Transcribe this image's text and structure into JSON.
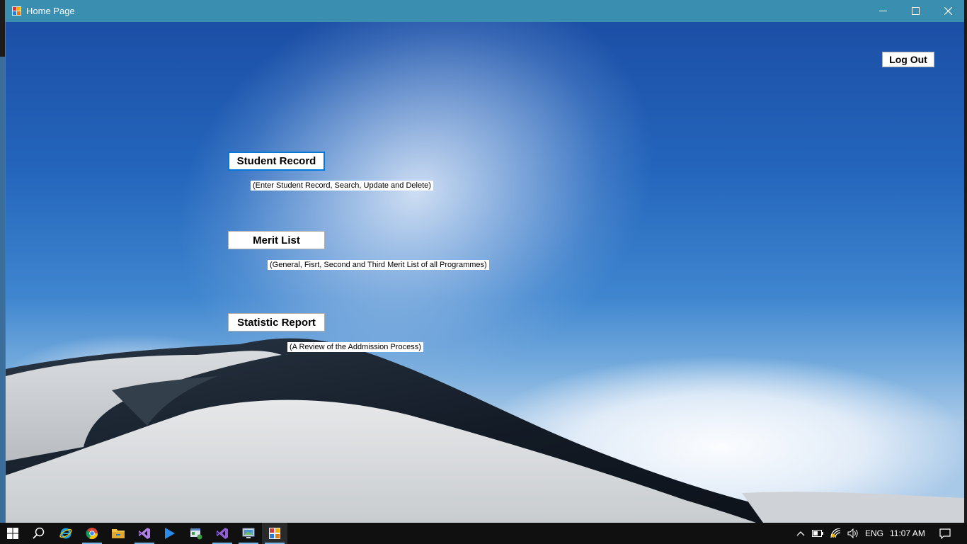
{
  "window": {
    "title": "Home Page",
    "controls": {
      "minimize": "minimize",
      "maximize": "maximize",
      "close": "close"
    }
  },
  "main": {
    "logout_label": "Log Out",
    "student_record_label": "Student Record",
    "student_record_caption": "(Enter Student Record, Search, Update and Delete)",
    "merit_list_label": "Merit List",
    "merit_list_caption": "(General, Fisrt, Second and Third Merit List of all Programmes)",
    "statistic_report_label": "Statistic Report",
    "statistic_report_caption": "(A Review of the Addmission Process)"
  },
  "taskbar": {
    "icons": [
      "start-icon",
      "search-icon",
      "internet-explorer-icon",
      "chrome-icon",
      "file-explorer-icon",
      "visual-studio-icon",
      "media-player-icon",
      "app-installer-icon",
      "visual-studio-2-icon",
      "remote-desktop-icon",
      "home-page-app-icon"
    ],
    "language": "ENG",
    "time": "11:07 AM"
  },
  "colors": {
    "titlebar": "#3a8fb0",
    "focus_border": "#0078d7",
    "taskbar": "#101010"
  }
}
